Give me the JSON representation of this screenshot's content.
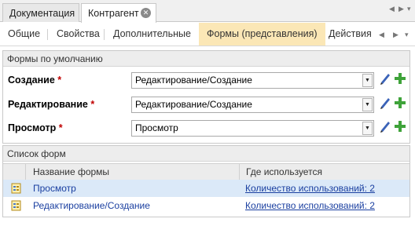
{
  "doc_tabs": [
    {
      "label": "Документация"
    },
    {
      "label": "Контрагент"
    }
  ],
  "sub_tabs": [
    {
      "label": "Общие"
    },
    {
      "label": "Свойства"
    },
    {
      "label": "Дополнительные"
    },
    {
      "label": "Формы (представления)"
    },
    {
      "label": "Действия"
    }
  ],
  "defaults_group": {
    "title": "Формы по умолчанию",
    "rows": [
      {
        "label": "Создание",
        "required": "*",
        "value": "Редактирование/Создание"
      },
      {
        "label": "Редактирование",
        "required": "*",
        "value": "Редактирование/Создание"
      },
      {
        "label": "Просмотр",
        "required": "*",
        "value": "Просмотр"
      }
    ]
  },
  "forms_list": {
    "title": "Список форм",
    "columns": [
      "Название формы",
      "Где используется"
    ],
    "rows": [
      {
        "name": "Просмотр",
        "usage": "Количество использований: 2"
      },
      {
        "name": "Редактирование/Создание",
        "usage": "Количество использований: 2"
      }
    ]
  },
  "colors": {
    "active_subtab": "#fbe7b6",
    "selected_row": "#dbe9f8",
    "link": "#1a3fa0",
    "required": "#c00000"
  }
}
